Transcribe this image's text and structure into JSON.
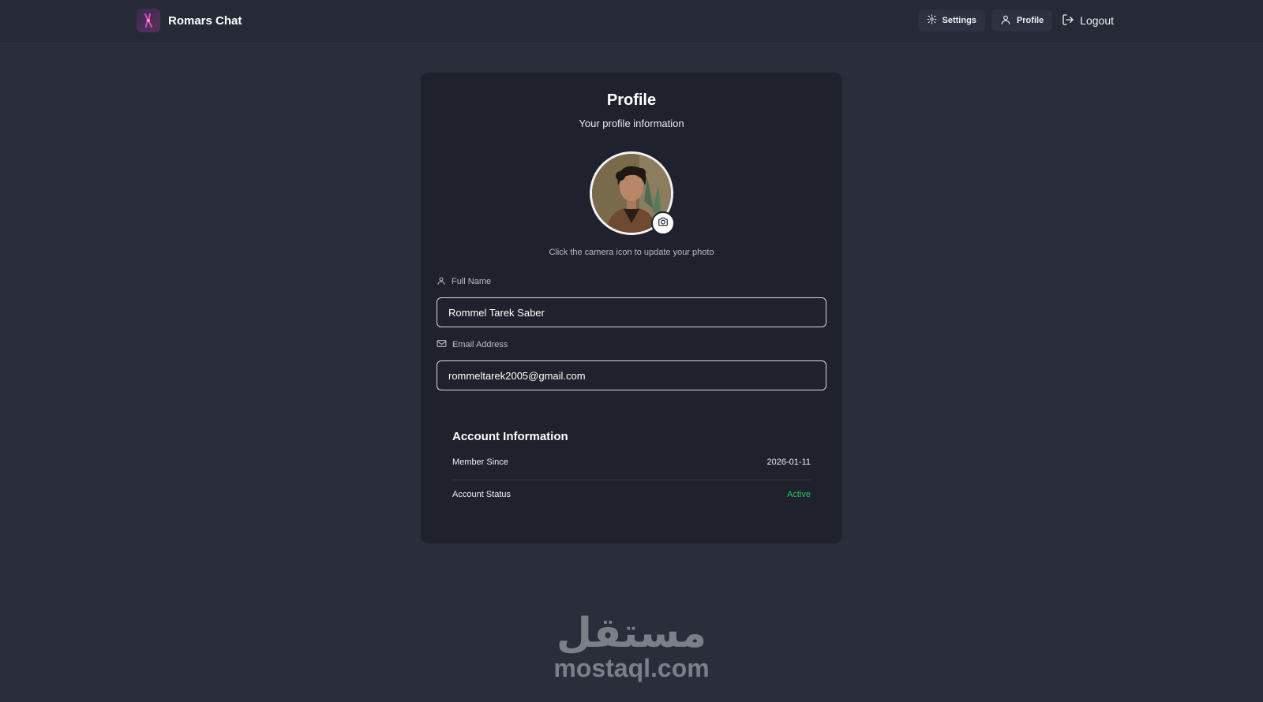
{
  "header": {
    "app_name": "Romars Chat",
    "nav": {
      "settings_label": "Settings",
      "profile_label": "Profile",
      "logout_label": "Logout"
    }
  },
  "profile_card": {
    "title": "Profile",
    "subtitle": "Your profile information",
    "photo_hint": "Click the camera icon to update your photo",
    "full_name": {
      "label": "Full Name",
      "value": "Rommel Tarek Saber"
    },
    "email": {
      "label": "Email Address",
      "value": "rommeltarek2005@gmail.com"
    },
    "account_info": {
      "title": "Account Information",
      "member_since_label": "Member Since",
      "member_since_value": "2026-01-11",
      "status_label": "Account Status",
      "status_value": "Active"
    }
  },
  "watermark": {
    "arabic": "مستقل",
    "latin": "mostaql.com"
  },
  "icons": {
    "logo": "app-logo-icon",
    "settings": "gear-icon",
    "profile": "user-icon",
    "logout": "logout-icon",
    "camera": "camera-icon",
    "name_field": "user-icon",
    "email_field": "mail-icon"
  },
  "colors": {
    "background": "#2a2e3b",
    "card": "#1f222c",
    "active_status": "#22c55e",
    "input_border": "#d9dbe0"
  }
}
